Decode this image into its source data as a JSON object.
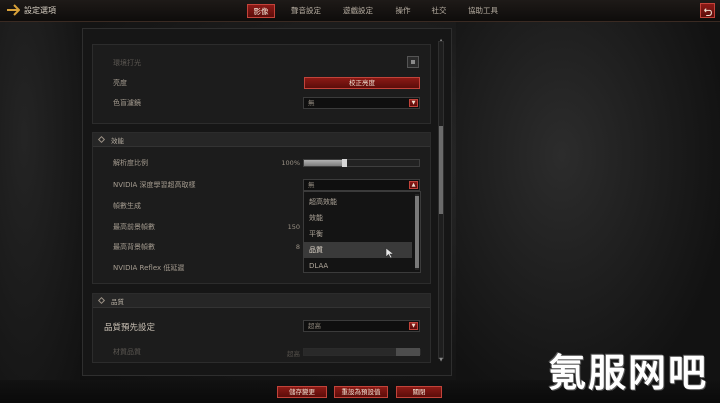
{
  "header": {
    "title": "設定選項",
    "tabs": [
      {
        "label": "影像",
        "active": true
      },
      {
        "label": "聲音設定",
        "active": false
      },
      {
        "label": "遊戲設定",
        "active": false
      },
      {
        "label": "操作",
        "active": false
      },
      {
        "label": "社交",
        "active": false
      },
      {
        "label": "協助工具",
        "active": false
      }
    ]
  },
  "display_section": {
    "rows": [
      {
        "label": "環境打光"
      },
      {
        "label": "亮度",
        "button_label": "校正亮度"
      },
      {
        "label": "色盲濾鏡",
        "dropdown_value": "無"
      }
    ]
  },
  "performance_section": {
    "title": "效能",
    "resolution_scale": {
      "label": "解析度比例",
      "value_text": "100%",
      "value": 0.35
    },
    "upscaler": {
      "label": "NVIDIA 深度學習超高取樣",
      "dropdown_value": "無"
    },
    "frame_generation": {
      "label": "幀數生成"
    },
    "max_fg_fps": {
      "label": "最高前景幀數",
      "value_text": "150"
    },
    "max_bg_fps": {
      "label": "最高背景幀數",
      "value_text": "8"
    },
    "reflex": {
      "label": "NVIDIA Reflex 低延遲"
    },
    "dropdown_options": [
      "超高效能",
      "效能",
      "平衡",
      "品質",
      "DLAA"
    ],
    "hovered_option": "品質"
  },
  "quality_section": {
    "title": "品質",
    "preset": {
      "label": "品質預先設定",
      "dropdown_value": "超高"
    },
    "texture_quality": {
      "label": "材質品質",
      "value_text": "超高"
    }
  },
  "footer": {
    "apply_label": "儲存變更",
    "reset_label": "重設為預設值",
    "close_label": "關閉"
  },
  "watermark": "氪服网吧",
  "colors": {
    "accent_red": "#8d1a16",
    "accent_border": "#c2433a"
  }
}
